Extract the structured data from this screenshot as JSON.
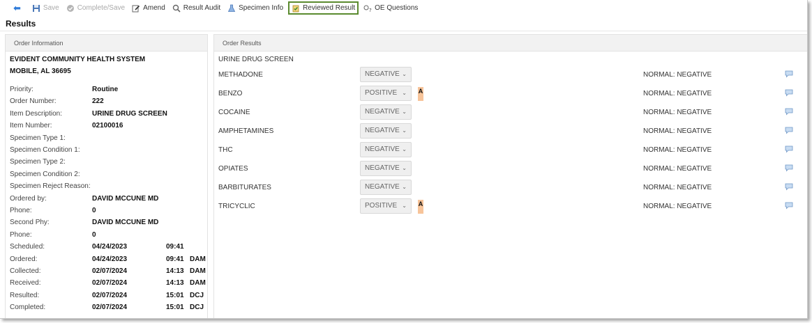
{
  "toolbar": {
    "save": "Save",
    "complete_save": "Complete/Save",
    "amend": "Amend",
    "result_audit": "Result Audit",
    "specimen_info": "Specimen Info",
    "reviewed_result": "Reviewed Result",
    "oe_questions": "OE Questions"
  },
  "page": {
    "title": "Results"
  },
  "order_info": {
    "header": "Order Information",
    "facility_name": "EVIDENT COMMUNITY HEALTH SYSTEM",
    "facility_city": "MOBILE, AL 36695",
    "fields": [
      {
        "label": "Priority:",
        "value": "Routine",
        "time": "",
        "user": ""
      },
      {
        "label": "Order Number:",
        "value": "222",
        "time": "",
        "user": ""
      },
      {
        "label": "Item Description:",
        "value": "URINE DRUG SCREEN",
        "time": "",
        "user": ""
      },
      {
        "label": "Item Number:",
        "value": "02100016",
        "time": "",
        "user": ""
      },
      {
        "label": "Specimen Type 1:",
        "value": "",
        "time": "",
        "user": ""
      },
      {
        "label": "Specimen Condition 1:",
        "value": "",
        "time": "",
        "user": ""
      },
      {
        "label": "Specimen Type 2:",
        "value": "",
        "time": "",
        "user": ""
      },
      {
        "label": "Specimen Condition 2:",
        "value": "",
        "time": "",
        "user": ""
      },
      {
        "label": "Specimen Reject Reason:",
        "value": "",
        "time": "",
        "user": ""
      },
      {
        "label": "Ordered by:",
        "value": "DAVID MCCUNE MD",
        "time": "",
        "user": ""
      },
      {
        "label": "Phone:",
        "value": "0",
        "time": "",
        "user": ""
      },
      {
        "label": "Second Phy:",
        "value": "DAVID MCCUNE MD",
        "time": "",
        "user": ""
      },
      {
        "label": "Phone:",
        "value": "0",
        "time": "",
        "user": ""
      },
      {
        "label": "Scheduled:",
        "value": "04/24/2023",
        "time": "09:41",
        "user": ""
      },
      {
        "label": "Ordered:",
        "value": "04/24/2023",
        "time": "09:41",
        "user": "DAM"
      },
      {
        "label": "Collected:",
        "value": "02/07/2024",
        "time": "14:13",
        "user": "DAM"
      },
      {
        "label": "Received:",
        "value": "02/07/2024",
        "time": "14:13",
        "user": "DAM"
      },
      {
        "label": "Resulted:",
        "value": "02/07/2024",
        "time": "15:01",
        "user": "DCJ"
      },
      {
        "label": "Completed:",
        "value": "02/07/2024",
        "time": "15:01",
        "user": "DCJ"
      }
    ]
  },
  "order_results": {
    "header": "Order Results",
    "panel_name": "URINE DRUG SCREEN",
    "tests": [
      {
        "name": "METHADONE",
        "result": "NEGATIVE",
        "flag": "",
        "normal": "NORMAL: NEGATIVE"
      },
      {
        "name": "BENZO",
        "result": "POSITIVE",
        "flag": "A",
        "normal": "NORMAL: NEGATIVE"
      },
      {
        "name": "COCAINE",
        "result": "NEGATIVE",
        "flag": "",
        "normal": "NORMAL: NEGATIVE"
      },
      {
        "name": "AMPHETAMINES",
        "result": "NEGATIVE",
        "flag": "",
        "normal": "NORMAL: NEGATIVE"
      },
      {
        "name": "THC",
        "result": "NEGATIVE",
        "flag": "",
        "normal": "NORMAL: NEGATIVE"
      },
      {
        "name": "OPIATES",
        "result": "NEGATIVE",
        "flag": "",
        "normal": "NORMAL: NEGATIVE"
      },
      {
        "name": "BARBITURATES",
        "result": "NEGATIVE",
        "flag": "",
        "normal": "NORMAL: NEGATIVE"
      },
      {
        "name": "TRICYCLIC",
        "result": "POSITIVE",
        "flag": "A",
        "normal": "NORMAL: NEGATIVE"
      }
    ]
  },
  "colors": {
    "flag_abnormal": "#f7c49a",
    "active_border": "#5a8a2e",
    "back_arrow": "#2f7bd9"
  }
}
